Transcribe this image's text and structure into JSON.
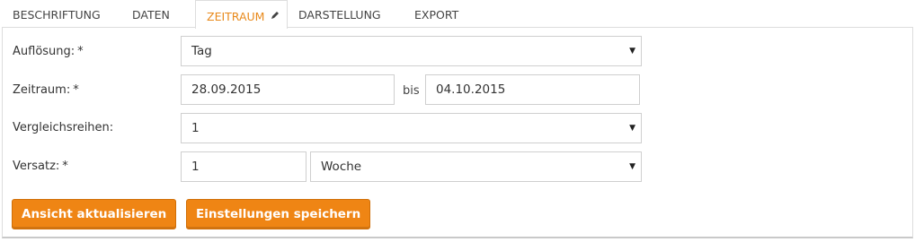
{
  "tabs": [
    {
      "label": "BESCHRIFTUNG"
    },
    {
      "label": "DATEN"
    },
    {
      "label": "ZEITRAUM"
    },
    {
      "label": "DARSTELLUNG"
    },
    {
      "label": "EXPORT"
    }
  ],
  "active_tab": "ZEITRAUM",
  "form": {
    "resolution": {
      "label": "Auflösung:",
      "required": "*",
      "value": "Tag"
    },
    "period": {
      "label": "Zeitraum:",
      "required": "*",
      "from": "28.09.2015",
      "separator": "bis",
      "to": "04.10.2015"
    },
    "comparison": {
      "label": "Vergleichsreihen:",
      "value": "1"
    },
    "offset": {
      "label": "Versatz:",
      "required": "*",
      "amount": "1",
      "unit": "Woche"
    }
  },
  "buttons": {
    "update": "Ansicht aktualisieren",
    "save": "Einstellungen speichern"
  },
  "colors": {
    "accent": "#ef8514",
    "active_tab_text": "#e8891b"
  },
  "icons": {
    "edit": "pencil-icon",
    "dropdown": "caret-down-icon"
  }
}
